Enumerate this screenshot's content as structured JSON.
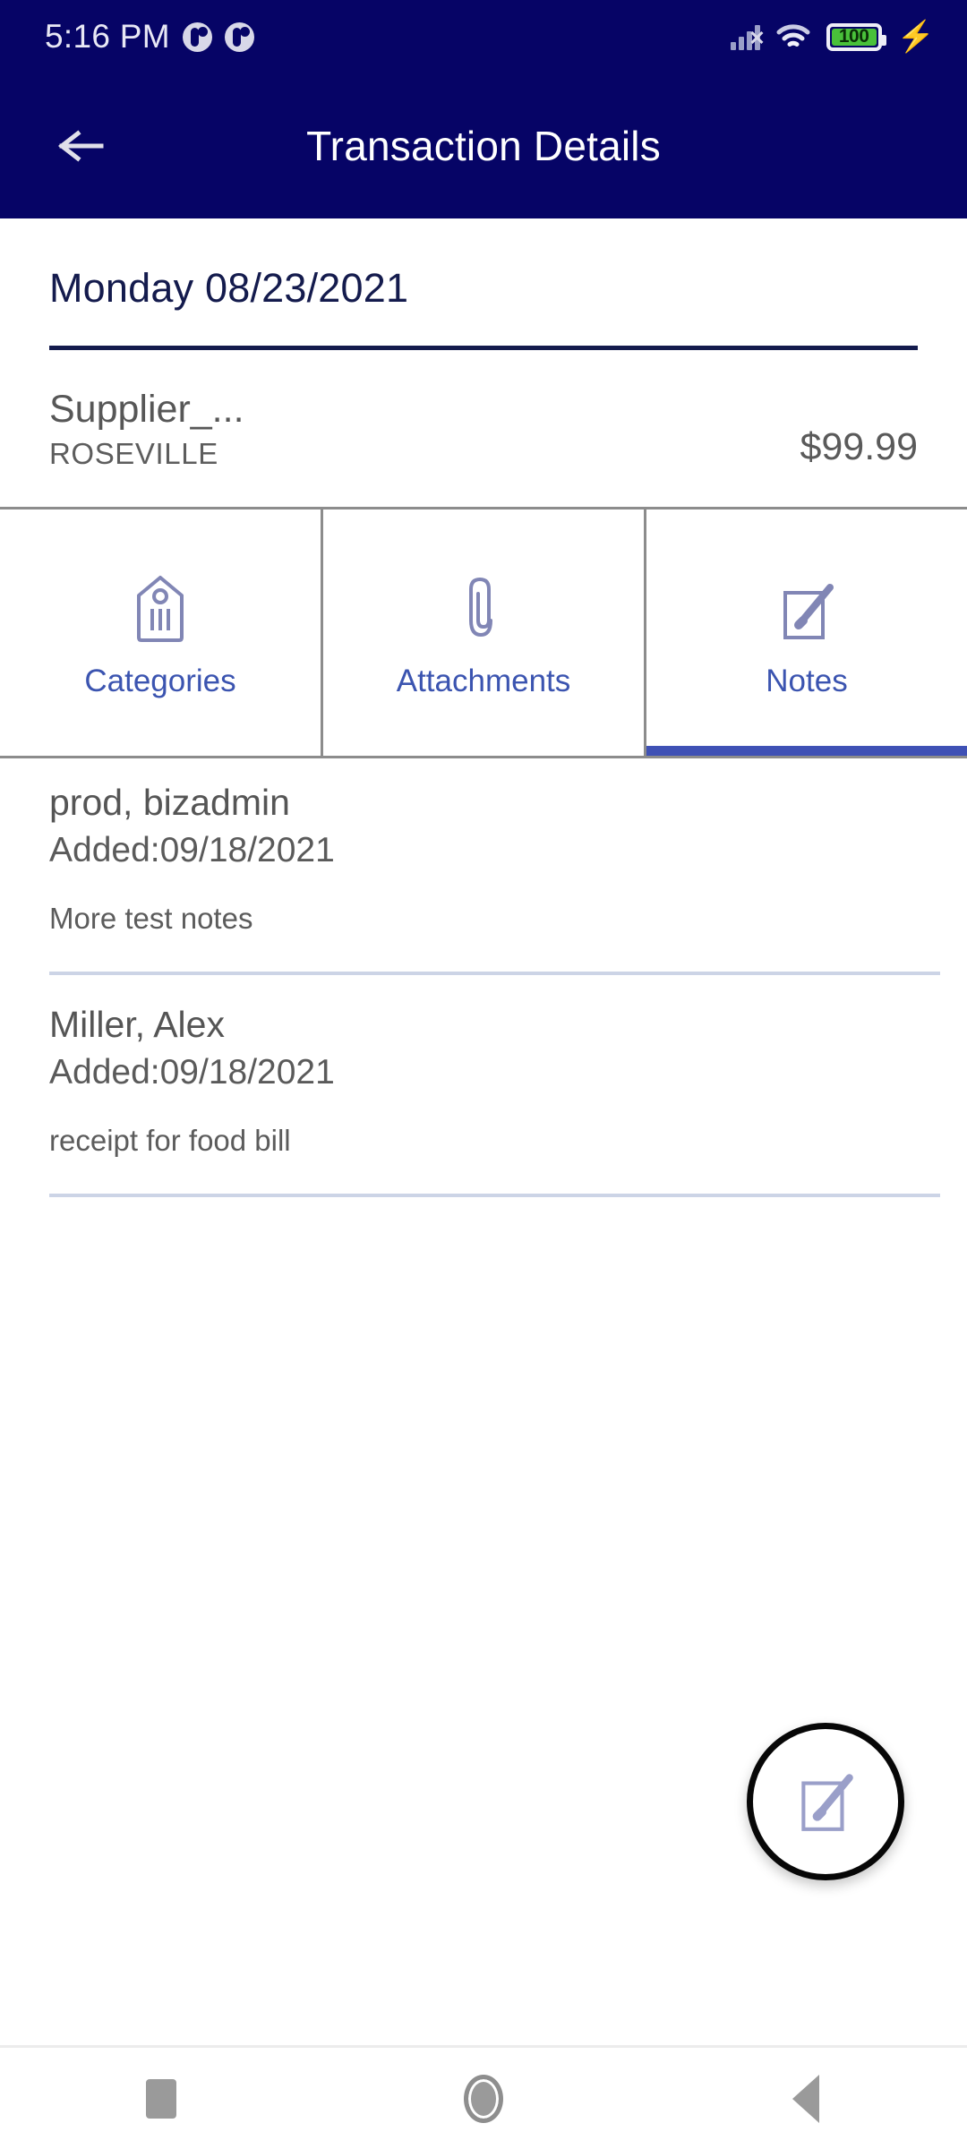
{
  "status_bar": {
    "time": "5:16 PM",
    "notification_icons": [
      "notification-dot-icon",
      "notification-dot-icon"
    ],
    "signal_icon": "signal-no-service-icon",
    "wifi_icon": "wifi-icon",
    "battery_level": "100",
    "battery_icon": "battery-icon",
    "charging_icon": "charging-bolt-icon",
    "colors": {
      "background": "#060466",
      "battery_fill": "#49c13a"
    }
  },
  "app_bar": {
    "back_icon": "back-arrow-icon",
    "title": "Transaction Details",
    "background": "#060466"
  },
  "transaction": {
    "date": "Monday 08/23/2021",
    "supplier_name": "Supplier_...",
    "supplier_city": "ROSEVILLE",
    "amount": "$99.99"
  },
  "tabs": [
    {
      "label": "Categories",
      "icon": "tag-icon",
      "selected": false
    },
    {
      "label": "Attachments",
      "icon": "paperclip-icon",
      "selected": false
    },
    {
      "label": "Notes",
      "icon": "note-edit-icon",
      "selected": true
    }
  ],
  "tab_accent_color": "#3f51b5",
  "notes": [
    {
      "author": "prod, bizadmin",
      "added": "Added:09/18/2021",
      "body": "More test notes"
    },
    {
      "author": "Miller, Alex",
      "added": "Added:09/18/2021",
      "body": "receipt for food bill"
    }
  ],
  "fab": {
    "icon": "note-edit-icon"
  },
  "nav_bar": {
    "recents_icon": "square-recents-icon",
    "home_icon": "circle-home-icon",
    "back_icon": "triangle-back-icon"
  }
}
